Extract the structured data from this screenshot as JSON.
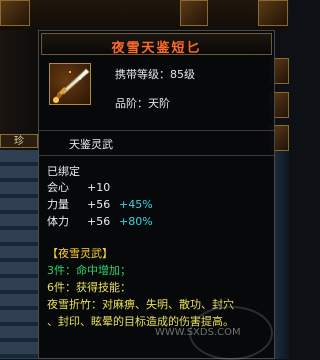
{
  "item": {
    "name": "夜雪天鉴短匕",
    "carry_level_label": "携带等级：",
    "carry_level_value": "85级",
    "quality_label": "品阶：",
    "quality_value": "天阶",
    "icon": "dagger-icon"
  },
  "set_header": "天鉴灵武",
  "stats": {
    "bound": "已绑定",
    "lines": [
      {
        "label": "会心",
        "value": "+10",
        "bonus": ""
      },
      {
        "label": "力量",
        "value": "+56",
        "bonus": "+45%"
      },
      {
        "label": "体力",
        "value": "+56",
        "bonus": "+80%"
      }
    ]
  },
  "set_effect": {
    "title": "【夜雪灵武】",
    "piece3": "3件：命中增加；",
    "piece6": "6件：获得技能：",
    "skill_line1": "夜雪折竹：对麻痹、失明、散功、封穴",
    "skill_line2": "、封印、眩晕的目标造成的伤害提高。"
  },
  "tab_chip": "珍",
  "watermark": "WWW.SXDS.COM",
  "colors": {
    "title": "#ff6a2a",
    "stat_bonus": "#33d6e6",
    "set_title": "#ffd23a",
    "set_piece": "#2ed66a",
    "skill_text": "#e8e05a"
  }
}
